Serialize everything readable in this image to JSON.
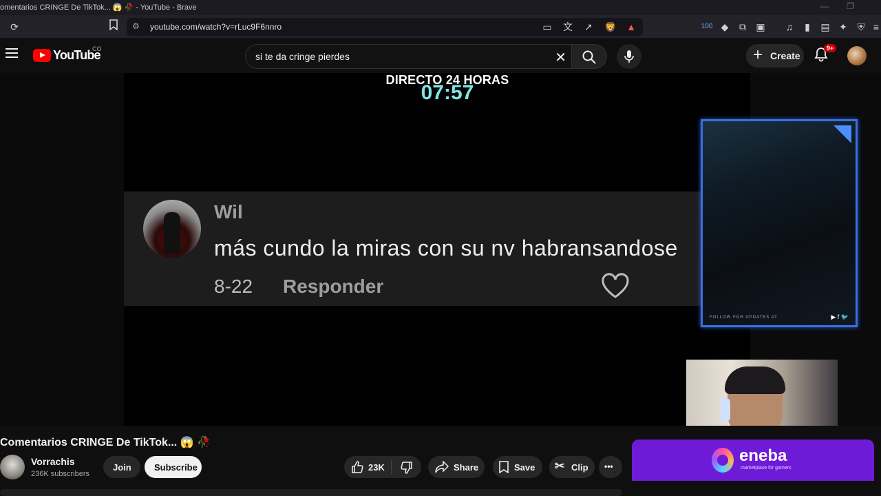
{
  "browser": {
    "window_title": "omentarios CRINGE De TikTok... 😱 🥀 - YouTube - Brave",
    "url": "youtube.com/watch?v=rLuc9F6nnro",
    "extension_badge": "100"
  },
  "masthead": {
    "brand": "YouTube",
    "country": "CO",
    "search_query": "si te da cringe pierdes",
    "create_label": "Create",
    "notif_count": "9+"
  },
  "video": {
    "overlay_title": "DIRECTO 24 HORAS",
    "overlay_time": "07:57",
    "comment": {
      "author": "Wil",
      "text": "más cundo la miras con su nv habransandose",
      "date": "8-22",
      "reply_label": "Responder"
    },
    "frame": {
      "follow_text": "FOLLOW FOR UPDATES AT",
      "socials": "▶ f 🐦"
    }
  },
  "below": {
    "video_title": "Comentarios CRINGE De TikTok... 😱 🥀",
    "channel_name": "Vorrachis",
    "subscribers": "236K subscribers",
    "join_label": "Join",
    "subscribe_label": "Subscribe",
    "likes": "23K",
    "share_label": "Share",
    "save_label": "Save",
    "clip_label": "Clip",
    "more_label": "•••"
  },
  "ad": {
    "brand": "eneba",
    "tagline": "marketplace for gamers"
  },
  "colors": {
    "yt_red": "#ff0000",
    "eneba_purple": "#6e1bd8",
    "time_cyan": "#7fe6e6",
    "frame_blue": "#3b6ee0"
  }
}
